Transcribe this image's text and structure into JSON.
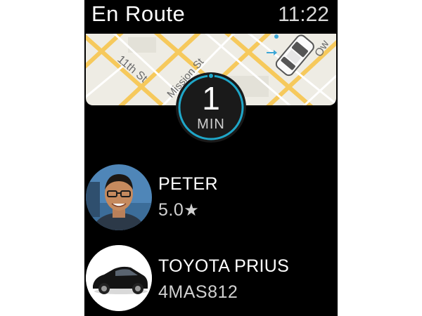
{
  "header": {
    "title": "En Route",
    "time": "11:22"
  },
  "map": {
    "street_labels": [
      "11th St",
      "Mission St"
    ],
    "partial_label": "Ow",
    "icons": [
      "car-icon",
      "direction-arrow-icon",
      "location-dot-icon"
    ]
  },
  "eta": {
    "value": "1",
    "unit": "MIN"
  },
  "driver": {
    "name": "PETER",
    "rating": "5.0",
    "rating_icon": "★"
  },
  "vehicle": {
    "model": "TOYOTA PRIUS",
    "plate": "4MAS812"
  },
  "colors": {
    "accent": "#1fa7c9",
    "background": "#000000",
    "map_road": "#f6c95c",
    "map_base": "#eeece4"
  }
}
